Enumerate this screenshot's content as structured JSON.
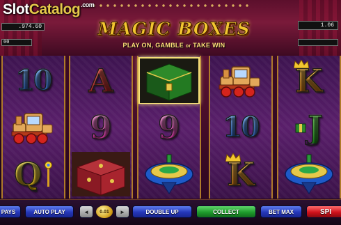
{
  "header": {
    "watermark": {
      "part1": "Slot",
      "part2": "Catalog",
      "part3": ".com"
    },
    "title": "MAGIC BOXES",
    "subtitle": {
      "part1": "PLAY ON, GAMBLE ",
      "part2": "or",
      "part3": " TAKE WIN"
    },
    "credit_value": ".974.60",
    "bet_value": "00",
    "win_value": "1.06"
  },
  "reels": [
    {
      "symbols": [
        "10",
        "toy-train",
        "Q"
      ]
    },
    {
      "symbols": [
        "A",
        "9",
        "magic-box-red"
      ]
    },
    {
      "symbols": [
        "magic-box-green",
        "9",
        "spinning-top"
      ]
    },
    {
      "symbols": [
        "toy-train",
        "10",
        "K"
      ]
    },
    {
      "symbols": [
        "K",
        "J",
        "spinning-top"
      ]
    }
  ],
  "reel_labels": {
    "r1c1": "10",
    "r1c3": "Q",
    "r2c1": "A",
    "r2c2": "9",
    "r3c2": "9",
    "r4c2": "10",
    "r4c3": "K",
    "r5c1": "K",
    "r5c2": "J"
  },
  "controls": {
    "pays": "PAYS",
    "auto_play": "AUTO PLAY",
    "coin_value": "0.01",
    "double_up": "DOUBLE UP",
    "collect": "COLLECT",
    "bet_max": "BET MAX",
    "spin": "SPI"
  },
  "colors": {
    "title_gold": "#f2c630",
    "button_blue": "#2436b8",
    "button_green": "#1e9a2c",
    "button_red": "#d0111b",
    "reel_purple": "#4a1a5c"
  }
}
